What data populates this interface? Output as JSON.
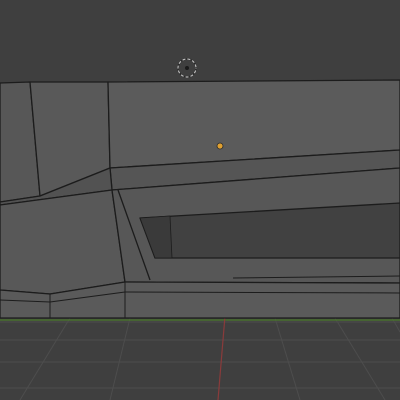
{
  "viewport": {
    "background": "#3f3f3f",
    "mesh_face_color": "#585858",
    "mesh_face_shadow": "#4a4a4a",
    "mesh_edge_color": "#1c1c1c",
    "grid_color": "#4d4d4d",
    "x_axis_color": "#8a3b3b",
    "y_axis_color": "#4a7a2a",
    "origin_color": "#e0a030",
    "cursor_icon": "3d-cursor-icon",
    "origin_icon": "object-origin-icon"
  }
}
